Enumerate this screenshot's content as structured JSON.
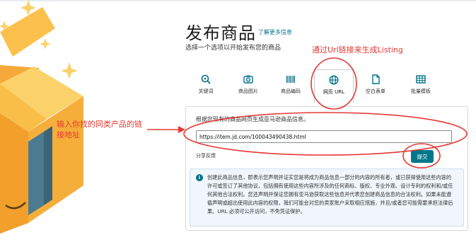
{
  "page": {
    "title": "发布商品",
    "learn_more": "了解更多信息",
    "subtitle": "选择一个选项以开始发布您的商品"
  },
  "annotations": {
    "top": "通过Url链接来生成Listing",
    "left": "输入你找的同类产品的链接地址"
  },
  "tabs": [
    {
      "label": "关键词",
      "icon": "search-icon"
    },
    {
      "label": "商品图片",
      "icon": "camera-icon"
    },
    {
      "label": "商品编码",
      "icon": "barcode-icon"
    },
    {
      "label": "网页 URL",
      "icon": "globe-icon",
      "active": true
    },
    {
      "label": "空白表单",
      "icon": "document-icon"
    },
    {
      "label": "批量模板",
      "icon": "spreadsheet-icon"
    }
  ],
  "panel": {
    "title": "根据您现有的商品网页生成亚马逊商品信息。",
    "url_value": "https://item.jd.com/100043490438.html",
    "feedback": "分享反馈",
    "submit": "提交",
    "info": "创建此商品信息，即表示您声明并证实您是将成为商品信息一部分的内容的所有者，或已获得使用这些内容的许可或签订了其他协议，包括拥有使用这些内容所涉及的任何商标、版权、专业外观、设计专利的权利和/或任何其他合法权利。您还声明并保证您拥有亚马逊获取这些信息并代表您创建商品信息的合法权利。如果未能遵循声明或超出使用此内容的权限，我们可能会对您的卖家账户采取相应措施，并且/或者您可能需要承担法律后果。URL 必须可公开访问，不免凭证保护。"
  },
  "colors": {
    "accent": "#00778a",
    "annotation": "#e53935",
    "box_gold": "#f8b431"
  }
}
